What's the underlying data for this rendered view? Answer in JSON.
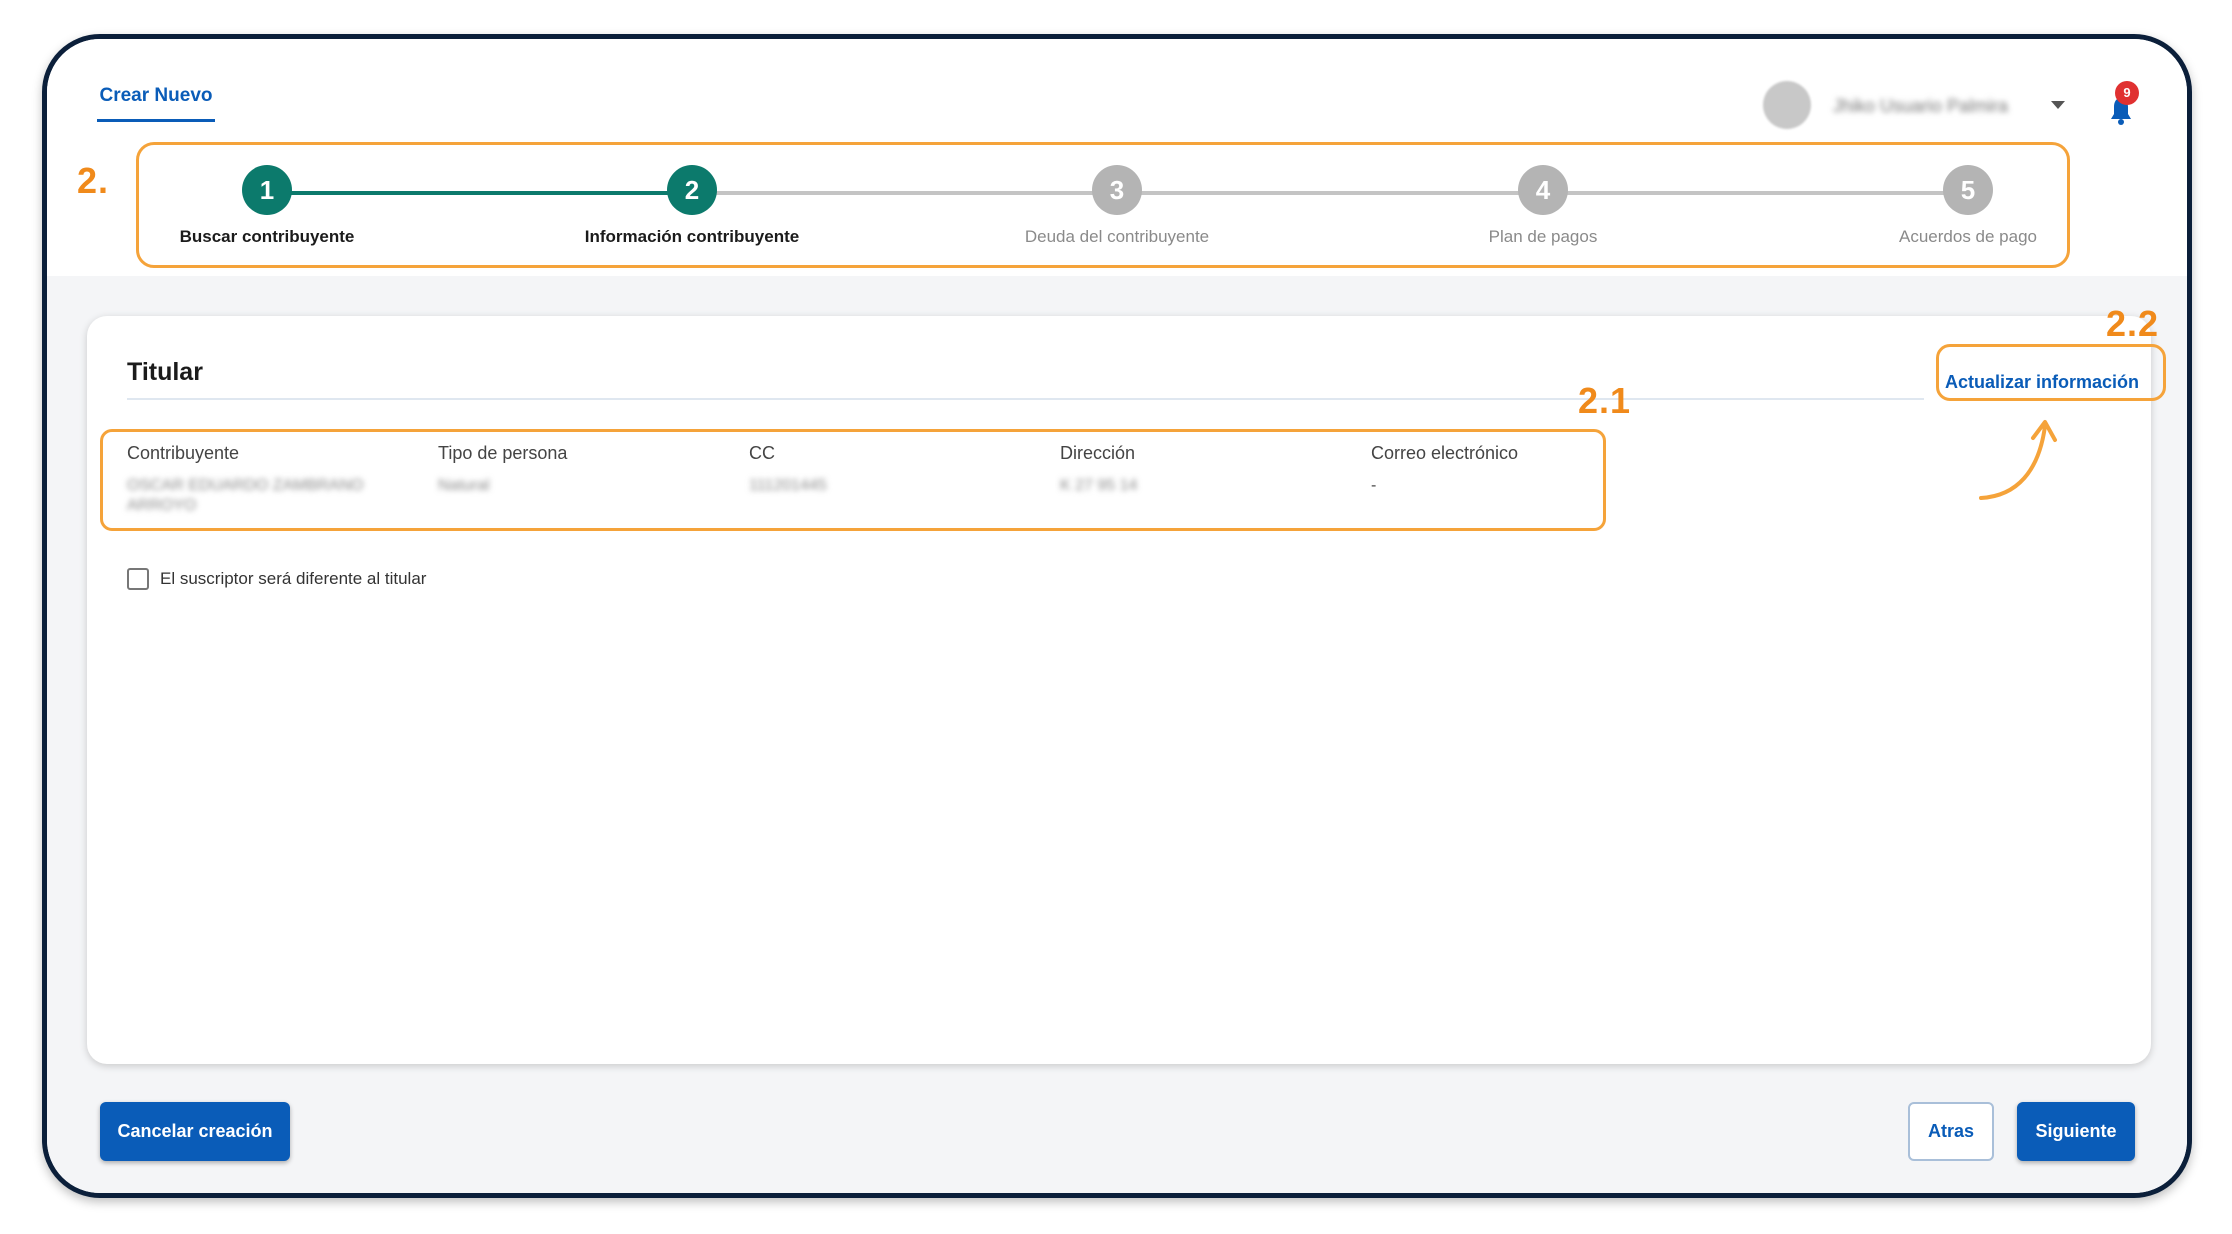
{
  "header": {
    "tab_label": "Crear Nuevo",
    "user_name": "Jhiko Usuario Palmira",
    "notification_count": "9"
  },
  "stepper": {
    "annotation": "2.",
    "steps": [
      {
        "number": "1",
        "label": "Buscar contribuyente",
        "state": "done"
      },
      {
        "number": "2",
        "label": "Información contribuyente",
        "state": "done"
      },
      {
        "number": "3",
        "label": "Deuda del contribuyente",
        "state": "pending"
      },
      {
        "number": "4",
        "label": "Plan de pagos",
        "state": "pending"
      },
      {
        "number": "5",
        "label": "Acuerdos de pago",
        "state": "pending"
      }
    ]
  },
  "card": {
    "title": "Titular",
    "update_button": "Actualizar información",
    "update_annotation": "2.2",
    "fields_annotation": "2.1",
    "fields": [
      {
        "label": "Contribuyente",
        "value": "OSCAR EDUARDO ZAMBRANO ARROYO"
      },
      {
        "label": "Tipo de persona",
        "value": "Natural"
      },
      {
        "label": "CC",
        "value": "111201445"
      },
      {
        "label": "Dirección",
        "value": "K 27 95 14"
      },
      {
        "label": "Correo electrónico",
        "value": "-"
      }
    ],
    "checkbox_label": "El suscriptor será diferente al titular"
  },
  "footer": {
    "cancel_button": "Cancelar creación",
    "back_button": "Atras",
    "next_button": "Siguiente"
  },
  "colors": {
    "primary": "#0a5cb8",
    "step_done": "#0c7a6c",
    "step_pending": "#b4b4b4",
    "annotation": "#f5a33a",
    "badge": "#e03131"
  }
}
